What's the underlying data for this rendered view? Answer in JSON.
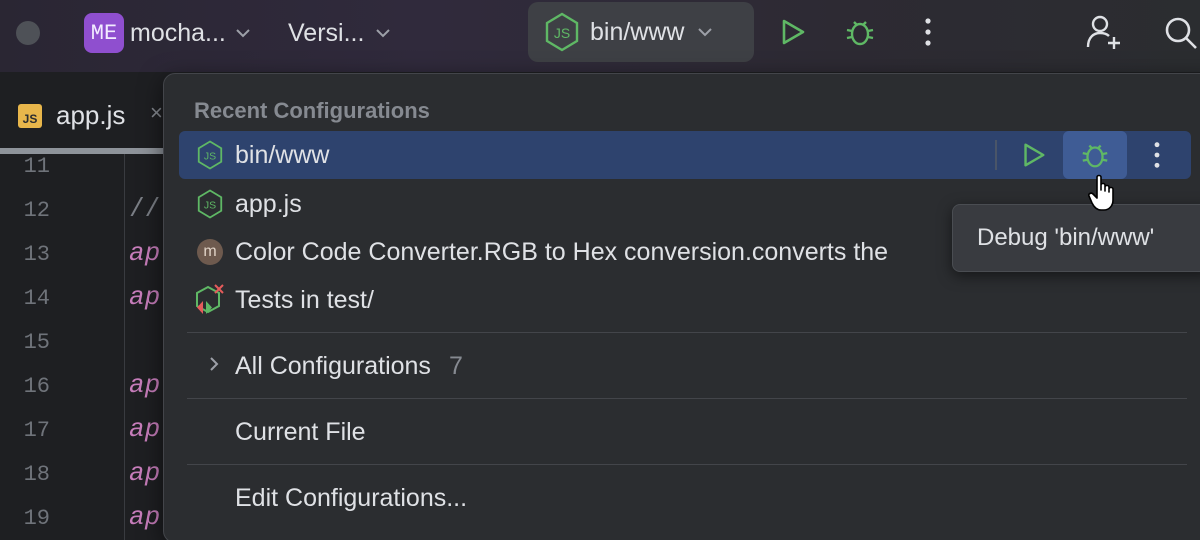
{
  "toolbar": {
    "project_badge": "ME",
    "project_name": "mocha...",
    "vcs_label": "Versi...",
    "run_config": "bin/www",
    "run_icon": "play-icon",
    "debug_icon": "bug-icon",
    "more_icon": "kebab-icon",
    "add_user_icon": "add-user-icon",
    "search_icon": "search-icon"
  },
  "editor": {
    "tab": {
      "icon_text": "JS",
      "label": "app.js",
      "close": "×"
    },
    "line_numbers": [
      "11",
      "12",
      "13",
      "14",
      "15",
      "16",
      "17",
      "18",
      "19"
    ],
    "code_fragments": [
      "//",
      "ap|",
      "ap|",
      "ap|",
      "ap|",
      "ap|",
      "ap|"
    ]
  },
  "popup": {
    "section_title": "Recent Configurations",
    "recent": [
      {
        "label": "bin/www",
        "icon": "nodejs-icon",
        "selected": true
      },
      {
        "label": "app.js",
        "icon": "nodejs-icon",
        "selected": false
      },
      {
        "label": "Color Code Converter.RGB to Hex conversion.converts the",
        "icon": "mocha-icon",
        "icon_text": "m",
        "selected": false
      },
      {
        "label": "Tests in test/",
        "icon": "node-test-icon",
        "selected": false
      }
    ],
    "all_configurations": {
      "label": "All Configurations",
      "count": "7"
    },
    "current_file": "Current File",
    "edit_configurations": "Edit Configurations..."
  },
  "tooltip": {
    "text": "Debug 'bin/www'"
  },
  "colors": {
    "accent_green": "#5fb865",
    "selection": "#2e436e",
    "debug_hover": "#3f5c95",
    "project_badge": "#8f4fcf",
    "code_ident": "#c77dbb"
  }
}
